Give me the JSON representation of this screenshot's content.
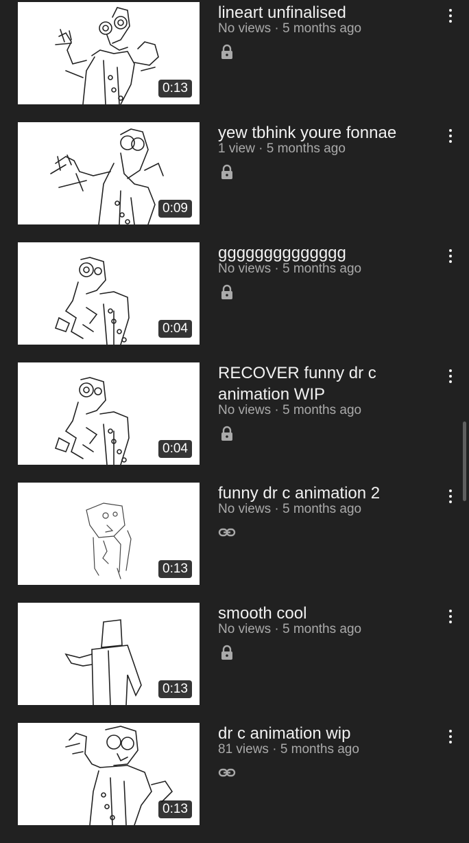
{
  "videos": [
    {
      "title": "lineart unfinalised",
      "views": "No views",
      "age": "5 months ago",
      "duration": "0:13",
      "privacy_icon": "lock-icon"
    },
    {
      "title": "yew tbhink youre fonnae",
      "views": "1 view",
      "age": "5 months ago",
      "duration": "0:09",
      "privacy_icon": "lock-icon"
    },
    {
      "title": "gggggggggggggg",
      "views": "No views",
      "age": "5 months ago",
      "duration": "0:04",
      "privacy_icon": "lock-icon"
    },
    {
      "title": "RECOVER funny dr c animation WIP",
      "views": "No views",
      "age": "5 months ago",
      "duration": "0:04",
      "privacy_icon": "lock-icon"
    },
    {
      "title": "funny dr c animation 2",
      "views": "No views",
      "age": "5 months ago",
      "duration": "0:13",
      "privacy_icon": "link-icon"
    },
    {
      "title": "smooth cool",
      "views": "No views",
      "age": "5 months ago",
      "duration": "0:13",
      "privacy_icon": "lock-icon"
    },
    {
      "title": "dr c animation wip",
      "views": "81 views",
      "age": "5 months ago",
      "duration": "0:13",
      "privacy_icon": "link-icon"
    }
  ],
  "separator": " · ",
  "colors": {
    "background": "#212121",
    "title": "#f1f1f1",
    "meta": "#aaaaaa",
    "thumbnail": "#ffffff"
  }
}
